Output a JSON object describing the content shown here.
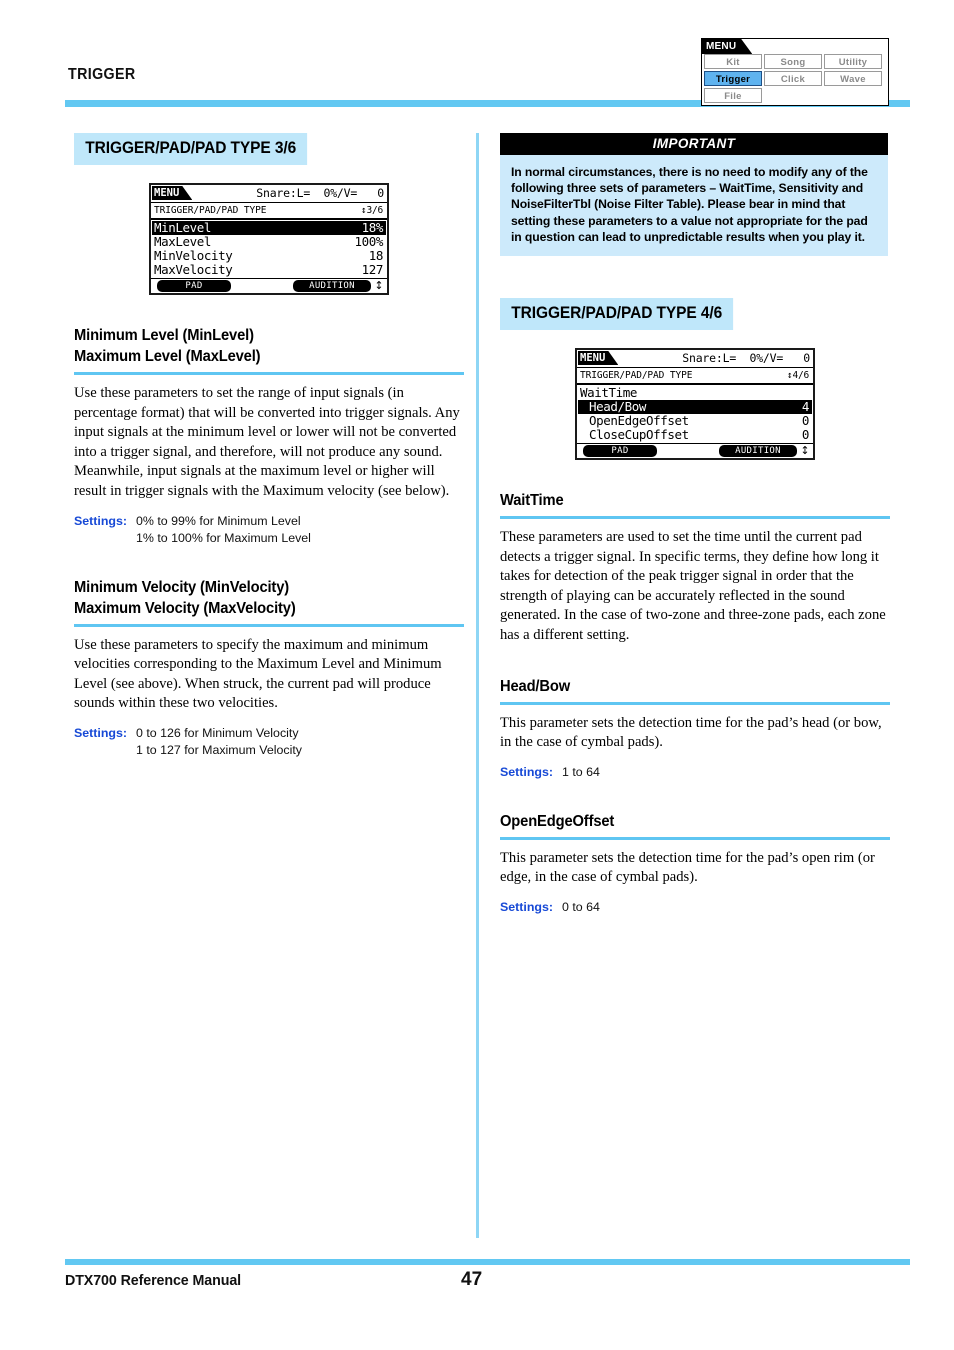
{
  "header": {
    "running_head": "TRIGGER",
    "menu_map": {
      "title": "MENU",
      "rows": [
        [
          {
            "label": "Kit",
            "active": false
          },
          {
            "label": "Song",
            "active": false
          },
          {
            "label": "Utility",
            "active": false
          }
        ],
        [
          {
            "label": "Trigger",
            "active": true
          },
          {
            "label": "Click",
            "active": false
          },
          {
            "label": "Wave",
            "active": false
          }
        ],
        [
          {
            "label": "File",
            "active": false
          }
        ]
      ]
    }
  },
  "colors": {
    "accent_rule": "#62c8f2",
    "heading_rule": "#5fc6f2",
    "screen_title_bg": "#bfe7fa",
    "settings_label": "#1749d6",
    "important_body_bg": "#cdeafb",
    "menu_active_bg": "#5fb3ef"
  },
  "left_column": {
    "screen_title": "TRIGGER/PAD/PAD TYPE  3/6",
    "lcd": {
      "menu_tab": "MENU",
      "kit_info": "Snare:L=  0%/V=   0",
      "path": "TRIGGER/PAD/PAD TYPE",
      "page": "↕3/6",
      "rows": [
        {
          "label": "MinLevel",
          "value": "18%",
          "selected": true,
          "group": false,
          "indent": false
        },
        {
          "label": "MaxLevel",
          "value": "100%",
          "selected": false,
          "group": false,
          "indent": false
        },
        {
          "label": "MinVelocity",
          "value": "18",
          "selected": false,
          "group": false,
          "indent": false
        },
        {
          "label": "MaxVelocity",
          "value": "127",
          "selected": false,
          "group": false,
          "indent": false
        }
      ],
      "soft_left": "PAD",
      "soft_right": "AUDITION",
      "soft_arrow": "↕"
    },
    "sections": [
      {
        "heading_lines": [
          "Minimum Level (MinLevel)",
          "Maximum Level (MaxLevel)"
        ],
        "body": "Use these parameters to set the range of input signals (in percentage format) that will be converted into trigger signals. Any input signals at the minimum level or lower will not be converted into a trigger signal, and therefore, will not produce any sound. Meanwhile, input signals at the maximum level or higher will result in trigger signals with the Maximum velocity (see below).",
        "settings_label": "Settings:",
        "settings_values": [
          "0% to 99% for Minimum Level",
          "1% to 100% for Maximum Level"
        ]
      },
      {
        "heading_lines": [
          "Minimum Velocity (MinVelocity)",
          "Maximum Velocity (MaxVelocity)"
        ],
        "body": "Use these parameters to specify the maximum and minimum velocities corresponding to the Maximum Level and Minimum Level (see above). When struck, the current pad will produce sounds within these two velocities.",
        "settings_label": "Settings:",
        "settings_values": [
          "0 to 126 for Minimum Velocity",
          "1 to 127 for Maximum Velocity"
        ]
      }
    ]
  },
  "right_column": {
    "important": {
      "title": "IMPORTANT",
      "body": "In normal circumstances, there is no need to modify any of the following three sets of parameters – WaitTime, Sensitivity and NoiseFilterTbl (Noise Filter Table). Please bear in mind that setting these parameters to a value not appropriate for the pad in question can lead to unpredictable results when you play it."
    },
    "screen_title": "TRIGGER/PAD/PAD TYPE  4/6",
    "lcd": {
      "menu_tab": "MENU",
      "kit_info": "Snare:L=  0%/V=   0",
      "path": "TRIGGER/PAD/PAD TYPE",
      "page": "↕4/6",
      "rows": [
        {
          "label": "WaitTime",
          "value": "",
          "selected": false,
          "group": true,
          "indent": false
        },
        {
          "label": "Head/Bow",
          "value": "4",
          "selected": true,
          "group": false,
          "indent": true
        },
        {
          "label": "OpenEdgeOffset",
          "value": "0",
          "selected": false,
          "group": false,
          "indent": true
        },
        {
          "label": "CloseCupOffset",
          "value": "0",
          "selected": false,
          "group": false,
          "indent": true
        }
      ],
      "soft_left": "PAD",
      "soft_right": "AUDITION",
      "soft_arrow": "↕"
    },
    "sections": [
      {
        "heading_lines": [
          "WaitTime"
        ],
        "body": "These parameters are used to set the time until the current pad detects a trigger signal. In specific terms, they define how long it takes for detection of the peak trigger signal in order that the strength of playing can be accurately reflected in the sound generated. In the case of two-zone and three-zone pads, each zone has a different setting.",
        "settings_label": "",
        "settings_values": []
      },
      {
        "heading_lines": [
          "Head/Bow"
        ],
        "body": "This parameter sets the detection time for the pad’s head (or bow, in the case of cymbal pads).",
        "settings_label": "Settings:",
        "settings_values": [
          "1 to 64"
        ]
      },
      {
        "heading_lines": [
          "OpenEdgeOffset"
        ],
        "body": "This parameter sets the detection time for the pad’s open rim (or edge, in the case of cymbal pads).",
        "settings_label": "Settings:",
        "settings_values": [
          "0 to 64"
        ]
      }
    ]
  },
  "footer": {
    "title": "DTX700  Reference Manual",
    "page_number": "47"
  }
}
